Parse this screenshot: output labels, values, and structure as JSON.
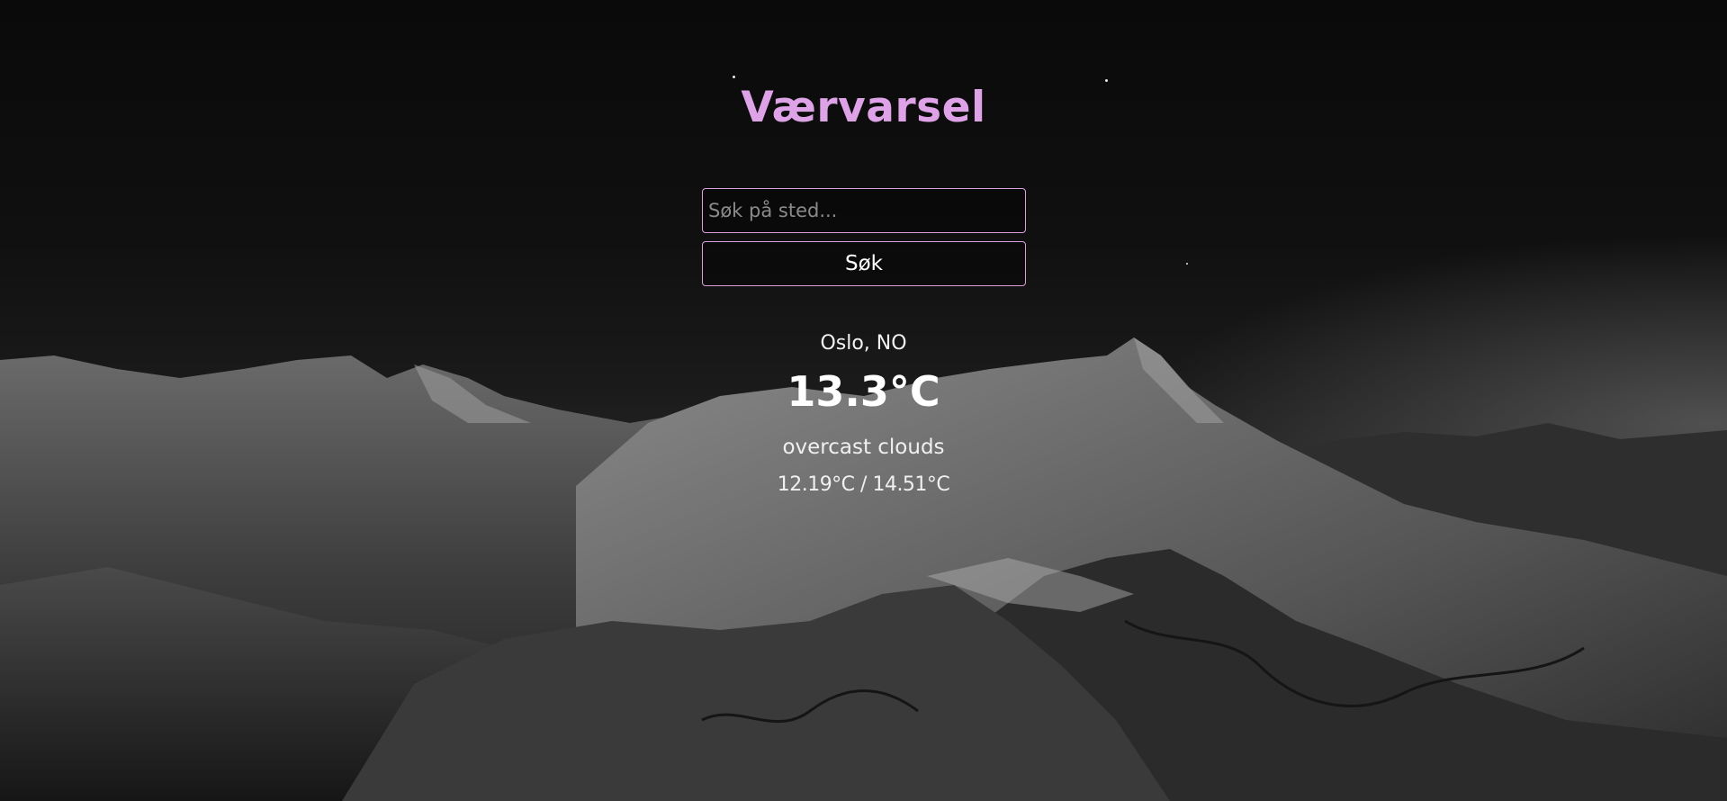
{
  "app": {
    "title": "Værvarsel"
  },
  "search": {
    "placeholder": "Søk på sted...",
    "value": "",
    "button_label": "Søk"
  },
  "weather": {
    "location": "Oslo, NO",
    "temperature": "13.3°C",
    "description": "overcast clouds",
    "min_max": "12.19°C / 14.51°C"
  },
  "colors": {
    "accent": "#dea2e6",
    "border": "#d8a3dc",
    "text": "#ffffff"
  }
}
